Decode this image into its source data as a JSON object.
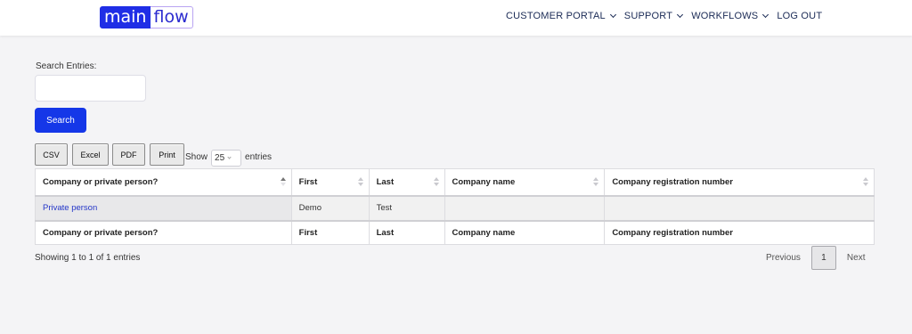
{
  "header": {
    "logo_main": "main",
    "logo_flow": "flow",
    "nav": [
      {
        "label": "CUSTOMER PORTAL"
      },
      {
        "label": "SUPPORT"
      },
      {
        "label": "WORKFLOWS"
      },
      {
        "label": "LOG OUT"
      }
    ]
  },
  "search": {
    "label": "Search Entries:",
    "value": "",
    "button_label": "Search"
  },
  "exports": {
    "csv": "CSV",
    "excel": "Excel",
    "pdf": "PDF",
    "print": "Print"
  },
  "length": {
    "show_label": "Show",
    "value": "25",
    "entries_label": "entries"
  },
  "table": {
    "columns": [
      "Company or private person?",
      "First",
      "Last",
      "Company name",
      "Company registration number"
    ],
    "sorted_column": "Company or private person?",
    "rows": [
      [
        "Private person",
        "Demo",
        "Test",
        "",
        ""
      ]
    ]
  },
  "info": "Showing 1 to 1 of 1 entries",
  "pagination": {
    "previous": "Previous",
    "current": "1",
    "next": "Next"
  },
  "colors": {
    "accent": "#1537e8",
    "logo_blue": "#1f2ee6",
    "link": "#2436c8",
    "nav_text": "#1a2a55",
    "background": "#f4f4f6"
  }
}
